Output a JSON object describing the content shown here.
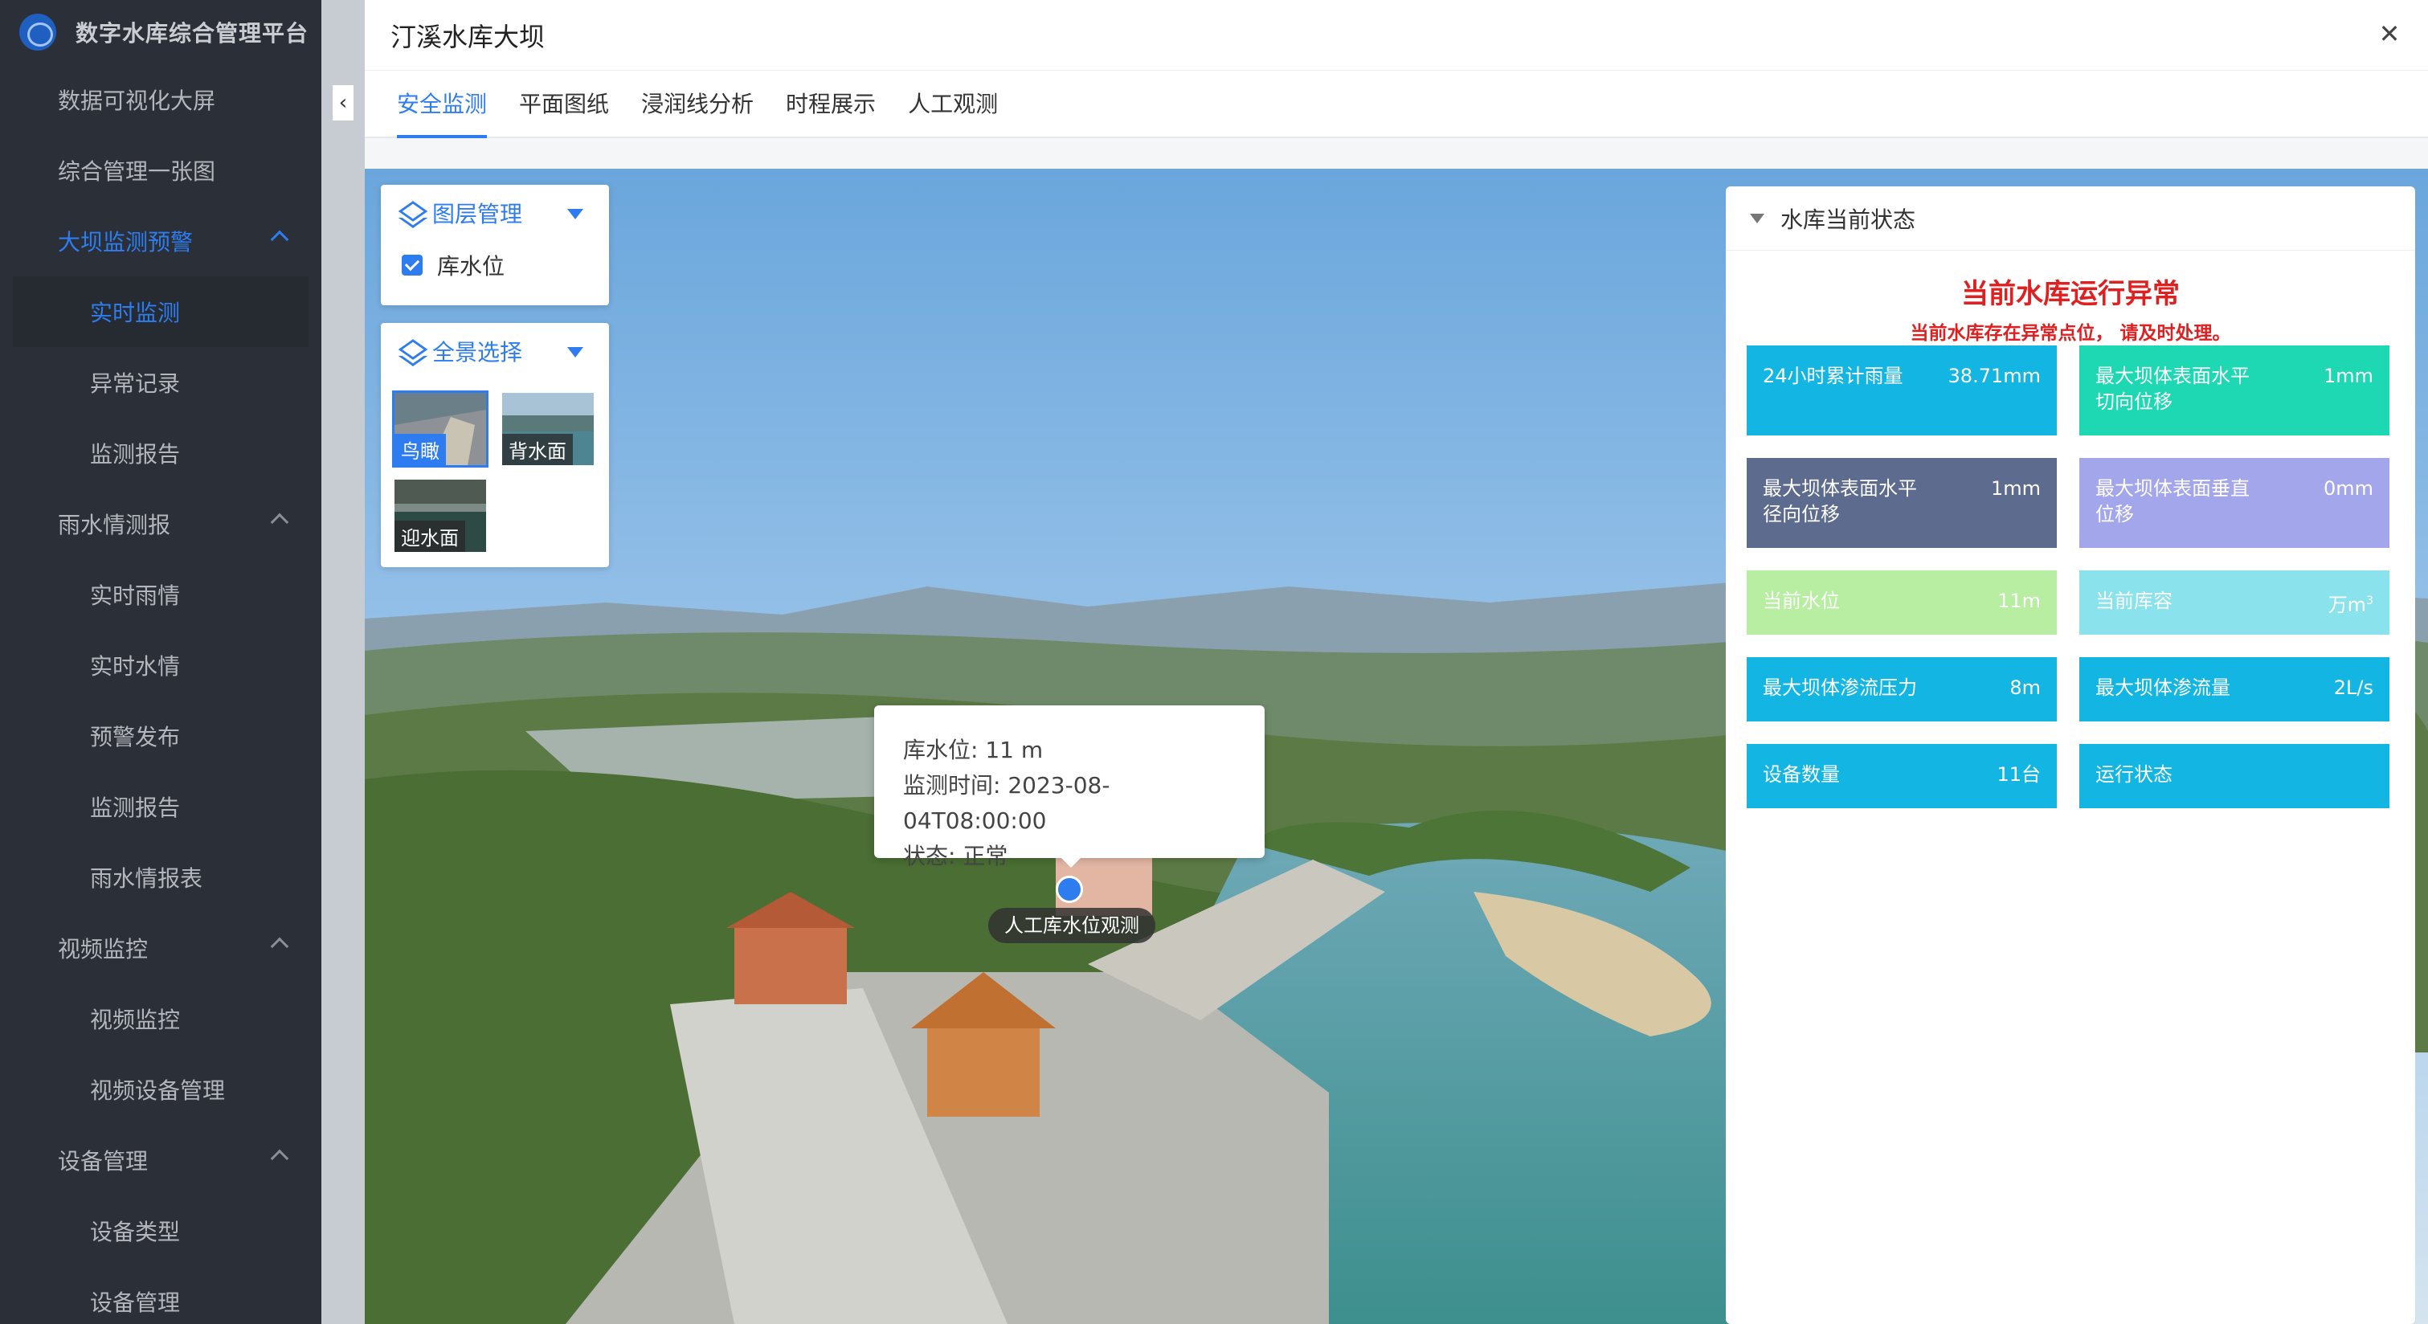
{
  "app": {
    "title": "数字水库综合管理平台"
  },
  "sidebar": {
    "items": [
      {
        "label": "数据可视化大屏",
        "type": "item"
      },
      {
        "label": "综合管理一张图",
        "type": "item"
      },
      {
        "label": "大坝监测预警",
        "type": "group",
        "expanded": true,
        "active": true
      },
      {
        "label": "实时监测",
        "type": "sub",
        "active": true
      },
      {
        "label": "异常记录",
        "type": "sub"
      },
      {
        "label": "监测报告",
        "type": "sub"
      },
      {
        "label": "雨水情测报",
        "type": "group",
        "expanded": true
      },
      {
        "label": "实时雨情",
        "type": "sub"
      },
      {
        "label": "实时水情",
        "type": "sub"
      },
      {
        "label": "预警发布",
        "type": "sub"
      },
      {
        "label": "监测报告",
        "type": "sub"
      },
      {
        "label": "雨水情报表",
        "type": "sub"
      },
      {
        "label": "视频监控",
        "type": "group",
        "expanded": true
      },
      {
        "label": "视频监控",
        "type": "sub"
      },
      {
        "label": "视频设备管理",
        "type": "sub"
      },
      {
        "label": "设备管理",
        "type": "group",
        "expanded": true
      },
      {
        "label": "设备类型",
        "type": "sub"
      },
      {
        "label": "设备管理",
        "type": "sub"
      }
    ]
  },
  "dialog": {
    "title": "汀溪水库大坝",
    "close_icon": "close-icon",
    "tabs": [
      {
        "label": "安全监测",
        "active": true
      },
      {
        "label": "平面图纸"
      },
      {
        "label": "浸润线分析"
      },
      {
        "label": "时程展示"
      },
      {
        "label": "人工观测"
      }
    ]
  },
  "layer_panel": {
    "title": "图层管理",
    "layers": [
      {
        "label": "库水位",
        "checked": true
      }
    ]
  },
  "pano_panel": {
    "title": "全景选择",
    "options": [
      {
        "label": "鸟瞰",
        "selected": true
      },
      {
        "label": "背水面"
      },
      {
        "label": "迎水面"
      }
    ]
  },
  "tooltip": {
    "line1": "库水位: 11 m",
    "line2": "监测时间: 2023-08-04T08:00:00",
    "line3": "状态: 正常"
  },
  "marker": {
    "label": "人工库水位观测"
  },
  "status": {
    "title": "水库当前状态",
    "alert_title": "当前水库运行异常",
    "alert_sub": "当前水库存在异常点位， 请及时处理。",
    "cards": [
      {
        "label": "24小时累计雨量",
        "value": "38.71mm",
        "color": "#13b5e3"
      },
      {
        "label": "最大坝体表面水平切向位移",
        "value": "1mm",
        "color": "#1ed8b4"
      },
      {
        "label": "最大坝体表面水平径向位移",
        "value": "1mm",
        "color": "#5c6b8e"
      },
      {
        "label": "最大坝体表面垂直位移",
        "value": "0mm",
        "color": "#a3a6ea"
      },
      {
        "label": "当前水位",
        "value": "11m",
        "color": "#b7eea1"
      },
      {
        "label": "当前库容",
        "value": "万m",
        "value_sup": "3",
        "color": "#89e2ec"
      },
      {
        "label": "最大坝体渗流压力",
        "value": "8m",
        "color": "#13b5e3"
      },
      {
        "label": "最大坝体渗流量",
        "value": "2L/s",
        "color": "#13b5e3"
      },
      {
        "label": "设备数量",
        "value": "11台",
        "color": "#13b5e3"
      },
      {
        "label": "运行状态",
        "value": "",
        "color": "#13b5e3"
      }
    ]
  }
}
